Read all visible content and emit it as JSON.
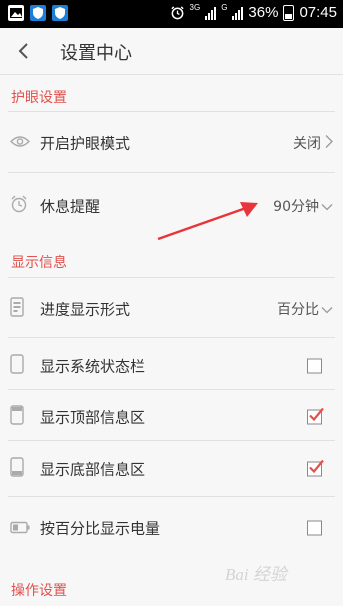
{
  "status_bar": {
    "network_3g": "3G",
    "network_g": "G",
    "battery": "36%",
    "time": "07:45"
  },
  "header": {
    "title": "设置中心"
  },
  "sections": [
    {
      "title": "护眼设置",
      "rows": [
        {
          "label": "开启护眼模式",
          "value": "关闭",
          "icon": "eye-icon",
          "control": "chevron"
        },
        {
          "label": "休息提醒",
          "value": "90分钟",
          "icon": "alarm-clock-icon",
          "control": "chevron"
        }
      ]
    },
    {
      "title": "显示信息",
      "rows": [
        {
          "label": "进度显示形式",
          "value": "百分比",
          "icon": "progress-icon",
          "control": "chevron"
        },
        {
          "label": "显示系统状态栏",
          "icon": "phone-icon",
          "checked": false
        },
        {
          "label": "显示顶部信息区",
          "icon": "phone-top-icon",
          "checked": true
        },
        {
          "label": "显示底部信息区",
          "icon": "phone-bottom-icon",
          "checked": true
        },
        {
          "label": "按百分比显示电量",
          "icon": "battery-icon",
          "checked": false
        }
      ]
    },
    {
      "title": "操作设置",
      "rows": []
    }
  ],
  "watermark": "Bai 经验",
  "colors": {
    "accent": "#e0524e",
    "check": "#e0524e",
    "statusbar": "#000000",
    "background": "#f7f7f7",
    "annotation_arrow": "#e8353b"
  }
}
